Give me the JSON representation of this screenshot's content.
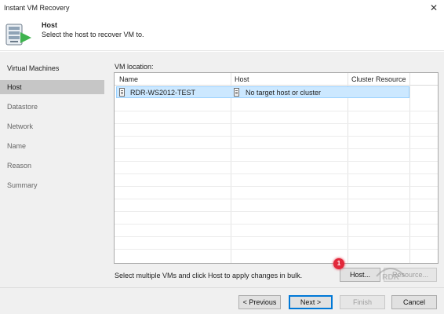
{
  "window": {
    "title": "Instant VM Recovery",
    "close_glyph": "✕"
  },
  "header": {
    "title": "Host",
    "subtitle": "Select the host to recover VM to."
  },
  "sidebar": {
    "steps": [
      {
        "label": "Virtual Machines"
      },
      {
        "label": "Host"
      },
      {
        "label": "Datastore"
      },
      {
        "label": "Network"
      },
      {
        "label": "Name"
      },
      {
        "label": "Reason"
      },
      {
        "label": "Summary"
      }
    ]
  },
  "main": {
    "vm_location_label": "VM location:",
    "columns": [
      "Name",
      "Host",
      "Cluster Resource"
    ],
    "rows": [
      {
        "name": "RDR-WS2012-TEST",
        "host": "No target host or cluster",
        "cluster": ""
      }
    ],
    "hint": "Select multiple VMs and click Host to apply changes in bulk.",
    "host_button": "Host...",
    "resource_button": "Resource...",
    "callout_number": "1",
    "watermark_text": "RDR"
  },
  "footer": {
    "previous": "< Previous",
    "next": "Next >",
    "finish": "Finish",
    "cancel": "Cancel"
  },
  "colors": {
    "selection": "#cce8ff",
    "callout": "#e2283a",
    "accent": "#0078d7",
    "icon_green": "#3fb34f"
  },
  "icons": {
    "header": "server-restore-icon",
    "vm": "vm-icon",
    "host": "host-icon",
    "close": "close-icon"
  }
}
